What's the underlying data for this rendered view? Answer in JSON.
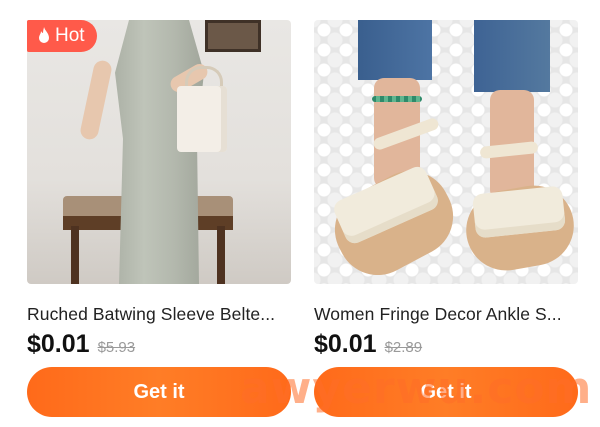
{
  "products": [
    {
      "title": "Ruched Batwing Sleeve Belte...",
      "price": "$0.01",
      "original_price": "$5.93",
      "badge": "Hot",
      "badge_icon": "flame-icon",
      "button_label": "Get it",
      "image": "woman-in-grey-ruched-dress"
    },
    {
      "title": "Women Fringe Decor Ankle S...",
      "price": "$0.01",
      "original_price": "$2.89",
      "button_label": "Get it",
      "image": "fringe-ankle-strap-sandals"
    }
  ],
  "watermark": "awyerwu.com",
  "colors": {
    "accent": "#ff6a1a",
    "badge": "#ff5a4a",
    "price": "#111111",
    "strike": "#9a9a9a"
  }
}
